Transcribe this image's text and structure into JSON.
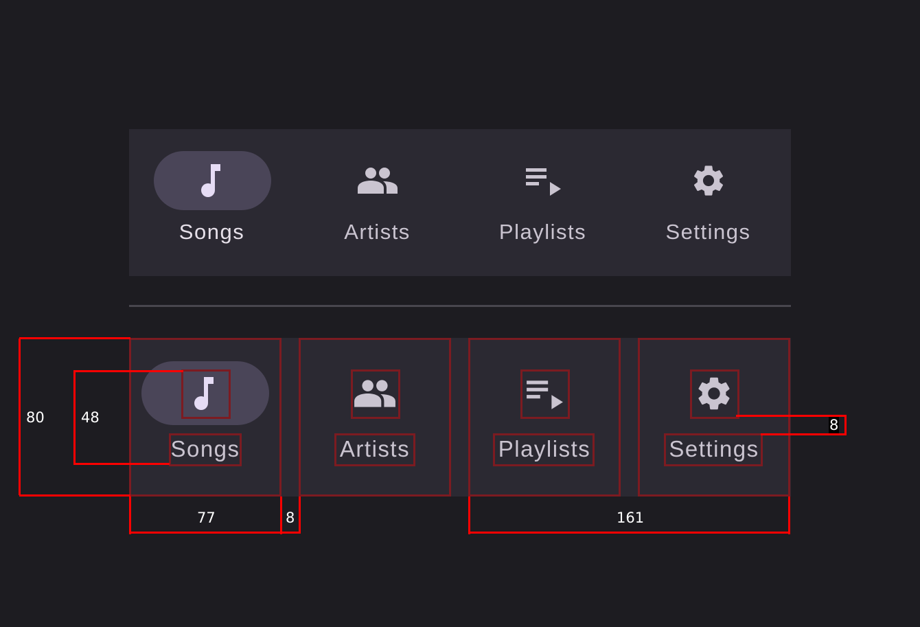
{
  "top_navbar": {
    "items": [
      {
        "label": "Songs",
        "icon": "music-note-icon",
        "active": true
      },
      {
        "label": "Artists",
        "icon": "people-icon",
        "active": false
      },
      {
        "label": "Playlists",
        "icon": "playlist-play-icon",
        "active": false
      },
      {
        "label": "Settings",
        "icon": "gear-icon",
        "active": false
      }
    ]
  },
  "bottom_navbar": {
    "items": [
      {
        "label": "Songs",
        "icon": "music-note-icon",
        "active": true
      },
      {
        "label": "Artists",
        "icon": "people-icon",
        "active": false
      },
      {
        "label": "Playlists",
        "icon": "playlist-play-icon",
        "active": false
      },
      {
        "label": "Settings",
        "icon": "gear-icon",
        "active": false
      }
    ]
  },
  "annotations": {
    "bar_height": "80",
    "content_height": "48",
    "item_width": "77",
    "item_gap": "8",
    "pair_width": "161",
    "icon_label_gap": "8"
  },
  "colors": {
    "background": "#1d1c21",
    "navbar_surface": "#2b2932",
    "active_indicator": "#4a4558",
    "active_icon": "#e6dcf5",
    "inactive_icon": "#cac4d0",
    "annotation_red": "#ff0000"
  }
}
